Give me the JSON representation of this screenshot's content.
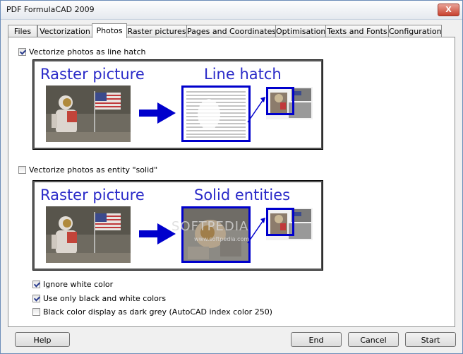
{
  "window": {
    "title": "PDF FormulaCAD 2009",
    "close_glyph": "X"
  },
  "tabs": [
    {
      "label": "Files",
      "active": false
    },
    {
      "label": "Vectorization",
      "active": false
    },
    {
      "label": "Photos",
      "active": true
    },
    {
      "label": "Raster pictures",
      "active": false
    },
    {
      "label": "Pages and Coordinates",
      "active": false
    },
    {
      "label": "Optimisation",
      "active": false
    },
    {
      "label": "Texts and Fonts",
      "active": false
    },
    {
      "label": "Configuration",
      "active": false
    }
  ],
  "options": {
    "line_hatch": {
      "label": "Vectorize photos as line hatch",
      "checked": true
    },
    "solid": {
      "label": "Vectorize photos as entity \"solid\"",
      "checked": false
    },
    "ignore_white": {
      "label": "Ignore white color",
      "checked": true
    },
    "black_white": {
      "label": "Use only black and white colors",
      "checked": true
    },
    "dark_grey": {
      "label": "Black color display as dark grey (AutoCAD index color 250)",
      "checked": false
    }
  },
  "illustration1": {
    "left_title": "Raster picture",
    "right_title": "Line hatch"
  },
  "illustration2": {
    "left_title": "Raster picture",
    "right_title": "Solid entities"
  },
  "watermark": "SOFTPEDIA",
  "watermark_url": "www.softpedia.com",
  "buttons": {
    "help": "Help",
    "end": "End",
    "cancel": "Cancel",
    "start": "Start"
  },
  "colors": {
    "accent_blue": "#0000cc",
    "title_blue": "#2a2ac8"
  }
}
